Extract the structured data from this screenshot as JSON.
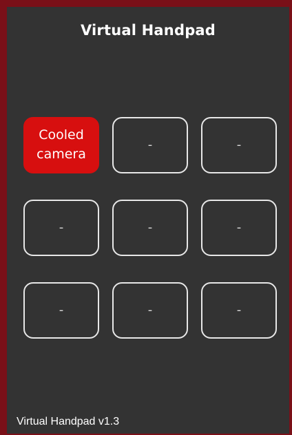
{
  "header": {
    "title": "Virtual Handpad"
  },
  "buttons": [
    {
      "label": "Cooled\ncamera"
    },
    {
      "label": "-"
    },
    {
      "label": "-"
    },
    {
      "label": "-"
    },
    {
      "label": "-"
    },
    {
      "label": "-"
    },
    {
      "label": "-"
    },
    {
      "label": "-"
    },
    {
      "label": "-"
    }
  ],
  "footer": {
    "version": "Virtual Handpad v1.3"
  },
  "colors": {
    "frame": "#7a1018",
    "background": "#333333",
    "active_button": "#d70f0f",
    "button_border": "#e8e8e8"
  }
}
